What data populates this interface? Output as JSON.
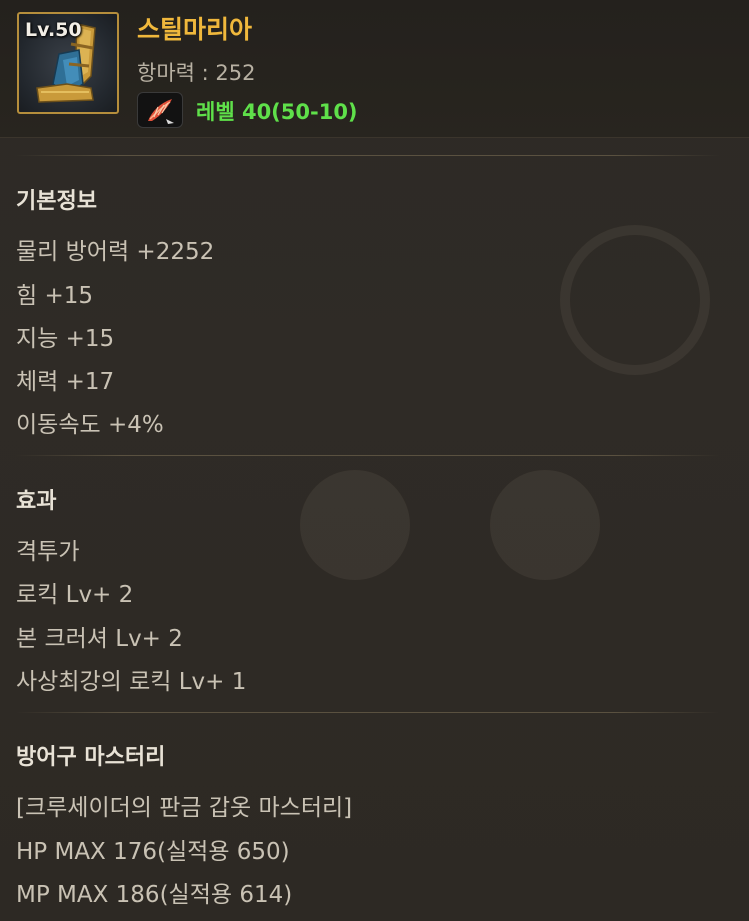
{
  "item": {
    "level_badge": "Lv.50",
    "name": "스틸마리아",
    "magic_resist": "항마력 : 252",
    "level_req": "레벨 40(50-10)",
    "icon": "boots-icon",
    "skill_icon": "feather-quill-icon"
  },
  "basic_info": {
    "title": "기본정보",
    "lines": [
      "물리 방어력 +2252",
      "힘 +15",
      "지능 +15",
      "체력 +17",
      "이동속도 +4%"
    ]
  },
  "effects": {
    "title": "효과",
    "lines": [
      "격투가",
      "로킥 Lv+ 2",
      "본 크러셔 Lv+ 2",
      "사상최강의 로킥 Lv+ 1"
    ]
  },
  "mastery": {
    "title": "방어구 마스터리",
    "lines": [
      "[크루세이더의 판금 갑옷 마스터리]",
      "HP MAX 176(실적용 650)",
      "MP MAX 186(실적용 614)"
    ]
  },
  "colors": {
    "item_name": "#f0b83c",
    "level_req": "#5fe04a",
    "frame_border": "#b58e3c"
  }
}
